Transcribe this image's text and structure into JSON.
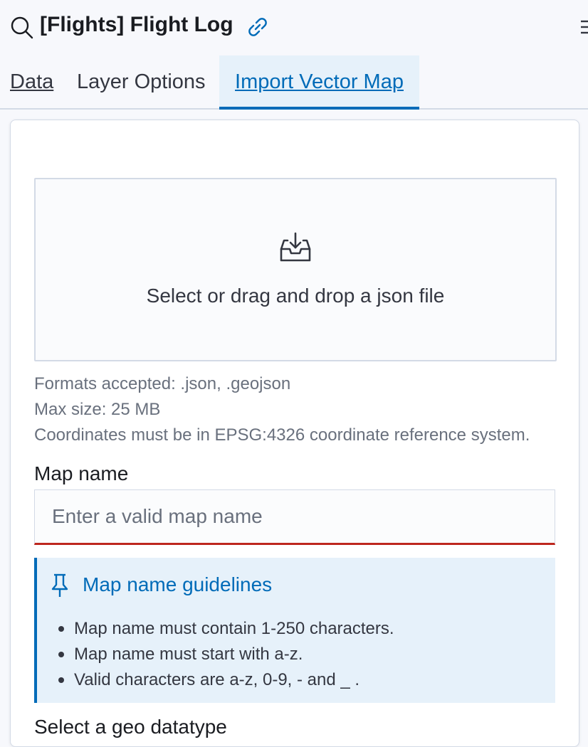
{
  "header": {
    "title": "[Flights] Flight Log"
  },
  "tabs": [
    {
      "label": "Data"
    },
    {
      "label": "Layer Options"
    },
    {
      "label": "Import Vector Map"
    }
  ],
  "upload": {
    "prompt": "Select or drag and drop a json file"
  },
  "help": {
    "formats": "Formats accepted: .json, .geojson",
    "max_size": "Max size: 25 MB",
    "coords": "Coordinates must be in EPSG:4326 coordinate reference system."
  },
  "map_name": {
    "label": "Map name",
    "placeholder": "Enter a valid map name",
    "value": ""
  },
  "guidelines": {
    "title": "Map name guidelines",
    "items": [
      "Map name must contain 1-250 characters.",
      "Map name must start with a-z.",
      "Valid characters are a-z, 0-9, - and _ ."
    ]
  },
  "geo_datatype": {
    "label": "Select a geo datatype"
  },
  "colors": {
    "accent": "#006bb8",
    "error": "#bd271e",
    "callout_bg": "#e6f1fa"
  },
  "icons": [
    "search-icon",
    "link-icon",
    "menu-icon",
    "upload-icon",
    "pin-icon"
  ]
}
